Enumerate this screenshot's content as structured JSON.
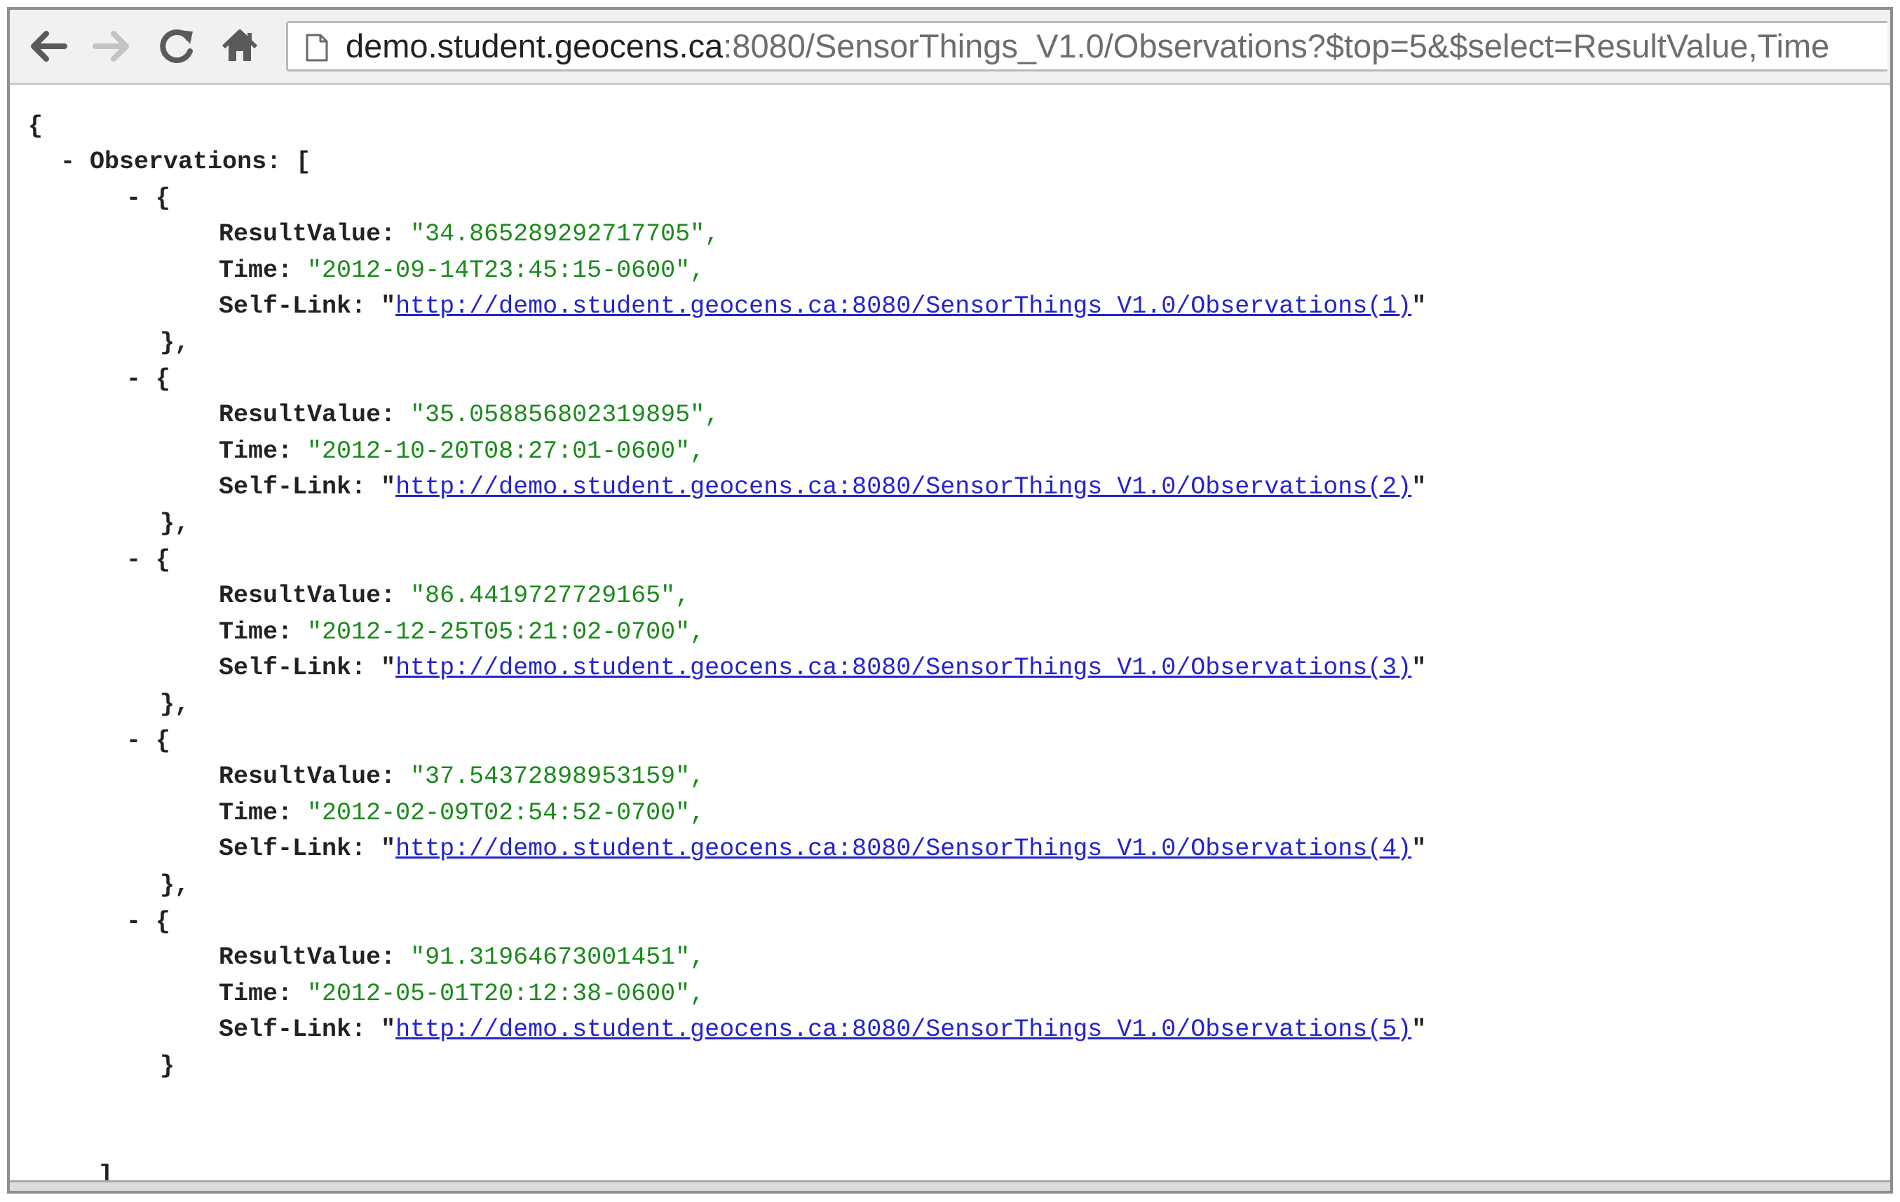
{
  "browser": {
    "url_host": "demo.student.geocens.ca",
    "url_rest": ":8080/SensorThings_V1.0/Observations?$top=5&$select=ResultValue,Time"
  },
  "json_view": {
    "open_brace": "{",
    "close_brace": "}",
    "collection_toggle": "-",
    "collection_key": "Observations:",
    "collection_open": "[",
    "collection_close": "]",
    "item_toggle": "-",
    "item_open": "{",
    "labels": {
      "result_value": "ResultValue:",
      "time": "Time:",
      "self_link": "Self-Link:"
    },
    "observations": [
      {
        "result_value": "\"34.865289292717705\",",
        "time": "\"2012-09-14T23:45:15-0600\",",
        "link": "http://demo.student.geocens.ca:8080/SensorThings_V1.0/Observations(1)",
        "item_close": "},"
      },
      {
        "result_value": "\"35.058856802319895\",",
        "time": "\"2012-10-20T08:27:01-0600\",",
        "link": "http://demo.student.geocens.ca:8080/SensorThings_V1.0/Observations(2)",
        "item_close": "},"
      },
      {
        "result_value": "\"86.4419727729165\",",
        "time": "\"2012-12-25T05:21:02-0700\",",
        "link": "http://demo.student.geocens.ca:8080/SensorThings_V1.0/Observations(3)",
        "item_close": "},"
      },
      {
        "result_value": "\"37.54372898953159\",",
        "time": "\"2012-02-09T02:54:52-0700\",",
        "link": "http://demo.student.geocens.ca:8080/SensorThings_V1.0/Observations(4)",
        "item_close": "},"
      },
      {
        "result_value": "\"91.31964673001451\",",
        "time": "\"2012-05-01T20:12:38-0600\",",
        "link": "http://demo.student.geocens.ca:8080/SensorThings_V1.0/Observations(5)",
        "item_close": "}"
      }
    ]
  }
}
